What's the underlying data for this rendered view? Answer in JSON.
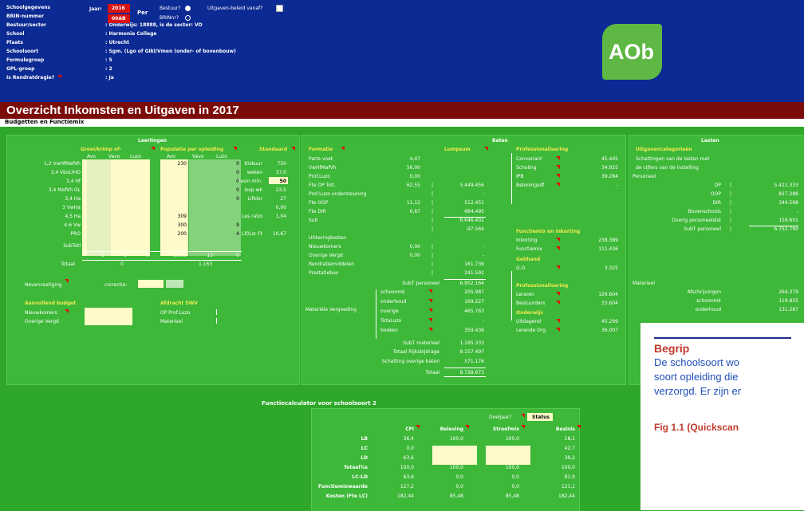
{
  "header": {
    "labels": [
      "Schoolgegevens",
      "BRIN-nummer",
      "Bestuur/sector",
      "School",
      "Plaats",
      "Schoolsoort",
      "Formulegroep",
      "GPL-groep",
      "Is Rendratdragie?"
    ],
    "values": [
      ": Onderwijs: 18888, is de sector: VO",
      ": Harmonie College",
      ": Utrecht",
      ": Sgm. (Lgo of GIkl/Vmen (onder- of bovenbouw)",
      ": 5",
      ": 2",
      ": Ja"
    ],
    "jaar_label": "Jaar:",
    "year": "2016",
    "brin": "00AB",
    "per_label": "Per",
    "bestuur_label": "Bestuur?",
    "brin_nr_label": "BRINnr?",
    "uitgaven_label": "Uitgaven-beleid vanaf?"
  },
  "logo": {
    "text": "AOb"
  },
  "title": "Overzicht Inkomsten en Uitgaven in 2017",
  "subtitle": "Budgetten en Functiemix",
  "leerlingen": {
    "heading": "Leerlingen",
    "groei_heading": "Groei/krimp of-",
    "populatie_heading": "Populatie per opleiding",
    "standaard_heading": "Standaard",
    "cols": [
      "Avo",
      "Vavo",
      "Luzo",
      "Avo",
      "Vavo",
      "Luzo"
    ],
    "rows": [
      "1,2 VwHfMafVh",
      "3,4 VboLIHO",
      "3,4 Hf",
      "3,4 MafVh GL",
      "3,4 Ha",
      "3 VwHa",
      "4,5 Ha",
      "4-6 Vw",
      "PRO",
      "SubTotl"
    ],
    "pop_avo": [
      "230",
      "",
      "",
      "",
      "",
      "",
      "309",
      "300",
      "200",
      ""
    ],
    "pop_luzo": [
      "0",
      "0",
      "0",
      "0",
      "0",
      "",
      "",
      "9",
      "4",
      "0"
    ],
    "subtotal": [
      "0",
      "0",
      "0",
      "1.155",
      "13",
      "0"
    ],
    "totaal_label": "Totaal",
    "totaal_values": [
      "0",
      "1.163"
    ],
    "standaard_labels": [
      "Klokuur",
      "weken",
      "lesin min.",
      "lesp.wk",
      "Lifklor",
      "",
      "Les ratio",
      "",
      "Llf/Lsr Ft"
    ],
    "standaard_values": [
      "750",
      "37,0",
      "50",
      "23,5",
      "27",
      "0,00",
      "1,04",
      "",
      "10,67"
    ],
    "nevenvestiging": "Nevenvestiging",
    "correctie": "correctie:",
    "aanvullend_heading": "Aanvullend budget",
    "aanvullend_labels": [
      "Nieuwkomers",
      "Overige Vergd"
    ],
    "afdracht_heading": "Afdracht SWV",
    "afdracht_labels": [
      "OP Prof.Luzo",
      "Materieel"
    ]
  },
  "baten": {
    "heading": "Baten",
    "formatie_heading": "Formatie",
    "lumpsum_heading": "Lumpsum",
    "rows": [
      {
        "label": "Parts voet",
        "a": "4,47",
        "b": ""
      },
      {
        "label": "VwHfMafVh",
        "a": "56,00",
        "b": ""
      },
      {
        "label": "Prof.Luzo",
        "a": "0,00",
        "b": ""
      },
      {
        "label": "Fte OP Totl.",
        "a": "62,55",
        "b": "5.449.456"
      },
      {
        "label": "Prof.Luzo ondersteuning",
        "a": "",
        "b": "-"
      },
      {
        "label": "Fte OOP",
        "a": "11,12",
        "b": "512.451"
      },
      {
        "label": "Fte DIR",
        "a": "6,67",
        "b": "684.495"
      },
      {
        "label": "Sub",
        "a": "",
        "b": "6.646.402"
      },
      {
        "label": "",
        "a": "",
        "b": "-97.564"
      },
      {
        "label": "Uitkeringkosten",
        "a": "",
        "b": ""
      },
      {
        "label": "Nieuwkomers",
        "a": "0,00",
        "b": "-"
      },
      {
        "label": "Overige Vergd",
        "a": "0,00",
        "b": "-"
      },
      {
        "label": "Rendratiemiddelen",
        "a": "",
        "b": "161.736"
      },
      {
        "label": "Prestatiebox",
        "a": "",
        "b": "241.592"
      }
    ],
    "subt_personeel": {
      "label": "SubT personeel",
      "value": "6.952.164"
    },
    "materiele_label": "Materiële Vergoeding",
    "mat_rows": [
      {
        "label": "schoonmk",
        "value": "205.987"
      },
      {
        "label": "onderhoud",
        "value": "169.227"
      },
      {
        "label": "overige",
        "value": "465.763"
      },
      {
        "label": "TotaLuzo",
        "value": "-"
      },
      {
        "label": "boeken",
        "value": "359.436"
      }
    ],
    "subt_materieel": {
      "label": "SubT materieel",
      "value": "1.195.333"
    },
    "totaal_rijks": {
      "label": "Totaal Rijksbijdrage",
      "value": "8.157.497"
    },
    "schatting": {
      "label": "Schatting overige baten",
      "value": "571.176"
    },
    "totaal": {
      "label": "Totaal",
      "value": "8.728.673"
    },
    "prof_heading": "Professionalisering",
    "prof_rows": [
      {
        "label": "Convenant",
        "value": "45.445"
      },
      {
        "label": "Scholing",
        "value": "34.925"
      },
      {
        "label": "IPB",
        "value": "39.284"
      },
      {
        "label": "Beloningsdf",
        "value": "-"
      }
    ],
    "functiemix_heading": "Functiemix en inkorting",
    "functiemix_rows": [
      {
        "label": "Inkorting",
        "value": "238.389"
      },
      {
        "label": "Functiemix",
        "value": "111.436"
      }
    ],
    "gebhand_heading": "Gebhand",
    "gebhand_rows": [
      {
        "label": "G.O.",
        "value": "3.325"
      }
    ],
    "prof2_heading": "Professionalisering",
    "prof2_rows": [
      {
        "label": "Leraren",
        "value": "126.604"
      },
      {
        "label": "Bestuurders",
        "value": "33.604"
      }
    ],
    "onderwijs_heading": "Onderwijs",
    "onderwijs_rows": [
      {
        "label": "Uitdagend",
        "value": "45.299"
      },
      {
        "label": "Lerende Org",
        "value": "36.007"
      }
    ]
  },
  "lasten": {
    "heading": "Lasten",
    "uitgaven_heading": "Uitgavencategorieën",
    "intro": [
      "Schattingen van de lasten met",
      "de cijfers van de instelling"
    ],
    "personeel_label": "Personeel",
    "rows": [
      {
        "label": "OP",
        "value": "5.421.333"
      },
      {
        "label": "OOP",
        "value": "827.288"
      },
      {
        "label": "DIR",
        "value": "344.568"
      },
      {
        "label": "Bovenschools",
        "value": "-"
      },
      {
        "label": "Overig personeelslst",
        "value": "159.601"
      },
      {
        "label": "SubT personeel",
        "value": "6.752.790"
      }
    ],
    "materieel_label": "Materieel",
    "mat_rows": [
      {
        "label": "Afschrijvingen",
        "value": "264.379"
      },
      {
        "label": "schoonmk",
        "value": "119.855"
      },
      {
        "label": "onderhoud",
        "value": "131.287"
      }
    ]
  },
  "calculator": {
    "title": "Functiecalculator voor schoolsoort 2",
    "doeljaar_label": "Doeljaar?",
    "doeljaar_value": "Status",
    "cols": [
      "CFI",
      "Beleving",
      "Streefmix",
      "Beslnis"
    ],
    "rows": [
      {
        "label": "LB",
        "v": [
          "36,4",
          "100,0",
          "100,0",
          "18,1"
        ]
      },
      {
        "label": "LC",
        "v": [
          "0,0",
          "",
          "",
          "42,7"
        ]
      },
      {
        "label": "LD",
        "v": [
          "63,6",
          "",
          "",
          "39,2"
        ]
      },
      {
        "label": "Totaal%s",
        "v": [
          "100,0",
          "100,0",
          "100,0",
          "100,0"
        ]
      },
      {
        "label": "LC-LD",
        "v": [
          "63,6",
          "0,0",
          "0,0",
          "81,9"
        ]
      },
      {
        "label": "Functiemixwaarde",
        "v": [
          "127,2",
          "0,0",
          "0,0",
          "121,1"
        ]
      },
      {
        "label": "Kosten (Fte LC)",
        "v": [
          "182,44",
          "85,48",
          "85,48",
          "182,44"
        ]
      }
    ]
  },
  "overlay": {
    "heading": "Begrip",
    "lines": [
      "De schoolsoort wo",
      "soort opleiding die",
      "verzorgd. Er zijn er"
    ],
    "fig": "Fig 1.1 (Quickscan"
  },
  "colors": {
    "header_bg": "#0c2a93",
    "title_bg": "#7a0b09",
    "panel_green": "#3db838",
    "accent_yellow": "#f1ea53",
    "input_cream": "#fffbc8",
    "marker_red": "#d9120f",
    "logo_green": "#5fb843"
  }
}
